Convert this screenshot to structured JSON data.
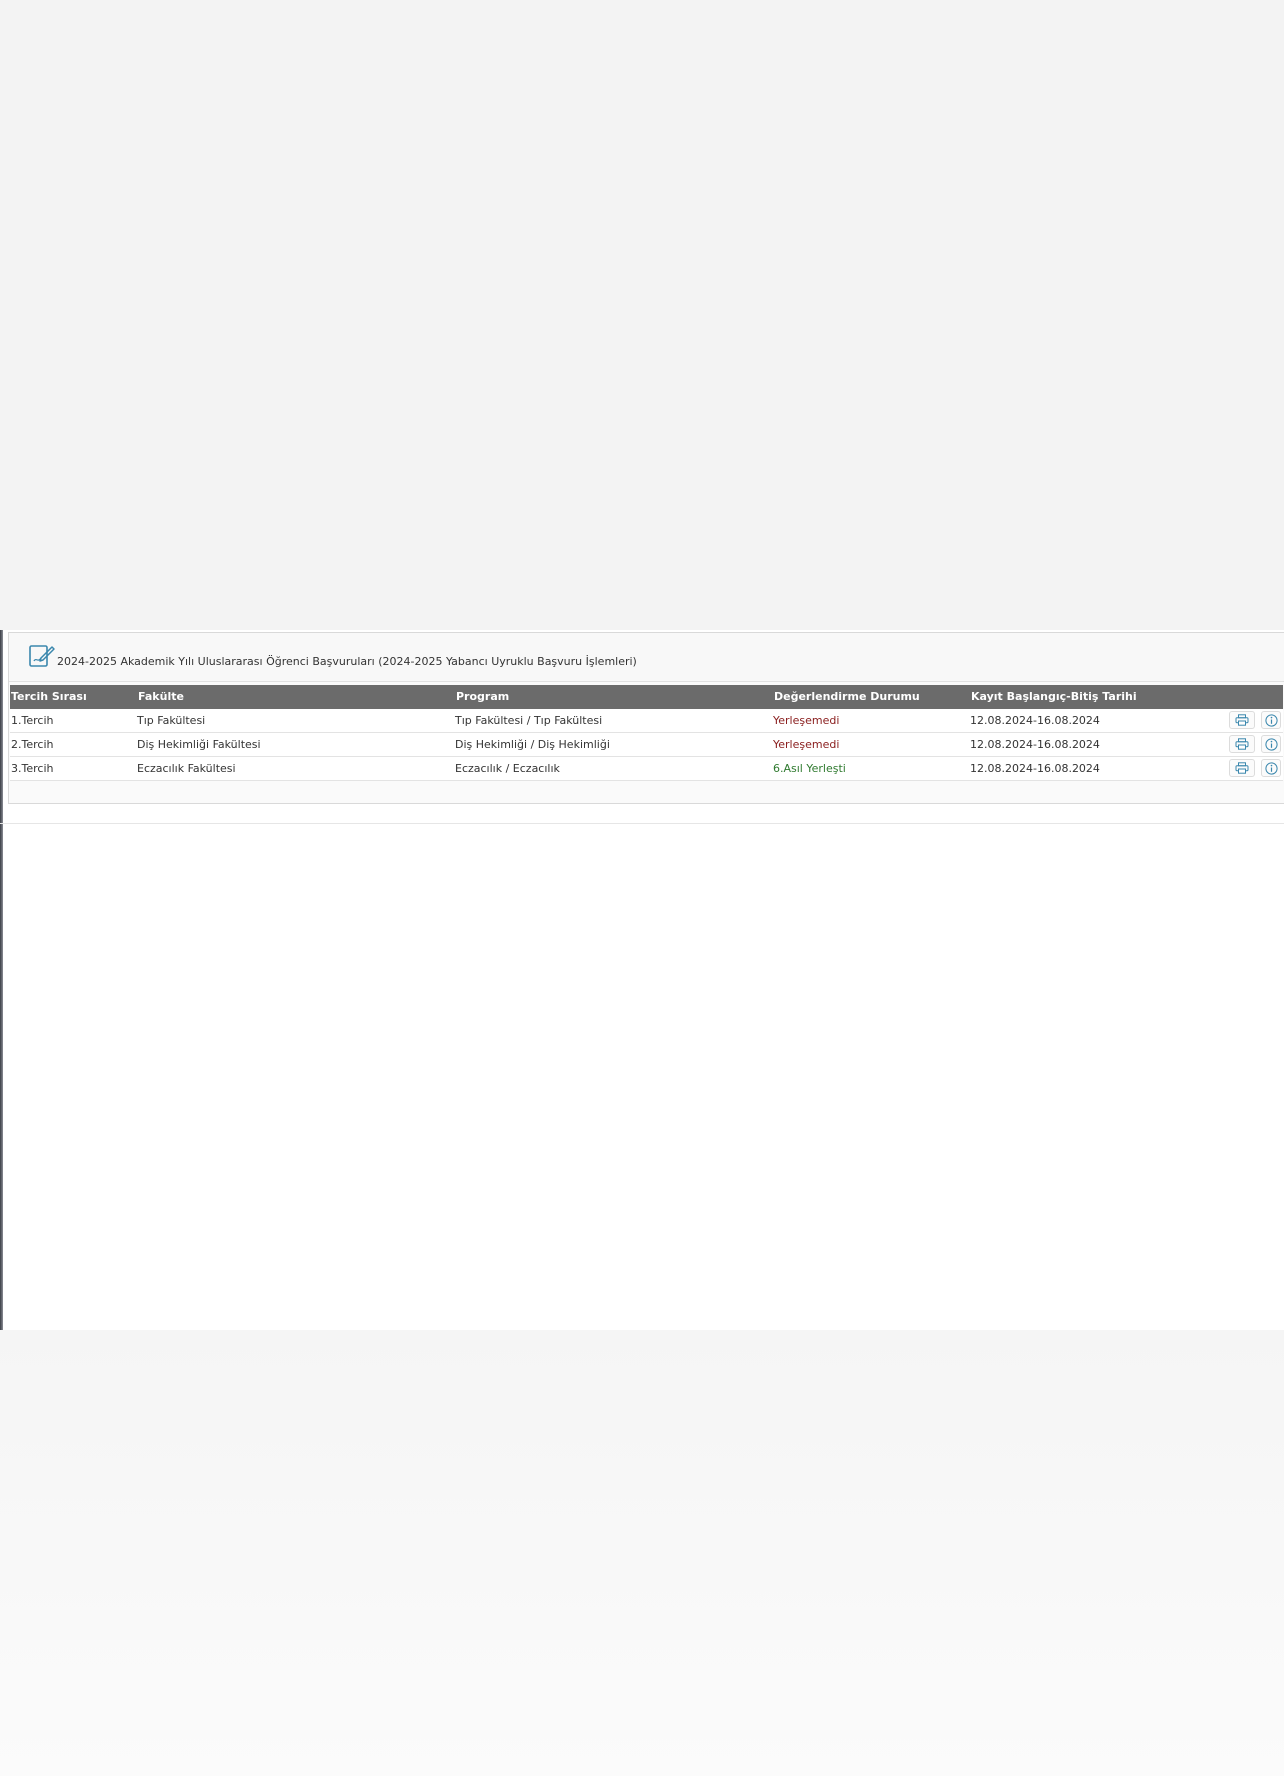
{
  "panel": {
    "title": "2024-2025 Akademik Yılı Uluslararası Öğrenci Başvuruları (2024-2025 Yabancı Uyruklu Başvuru İşlemleri)",
    "icon": "edit-document-icon"
  },
  "table": {
    "headers": {
      "rank": "Tercih Sırası",
      "faculty": "Fakülte",
      "program": "Program",
      "status": "Değerlendirme Durumu",
      "dates": "Kayıt Başlangıç-Bitiş Tarihi"
    },
    "rows": [
      {
        "rank": "1.Tercih",
        "faculty": "Tıp Fakültesi",
        "program": "Tıp Fakültesi / Tıp Fakültesi",
        "status": "Yerleşemedi",
        "dates": "12.08.2024-16.08.2024"
      },
      {
        "rank": "2.Tercih",
        "faculty": "Diş Hekimliği Fakültesi",
        "program": "Diş Hekimliği / Diş Hekimliği",
        "status": "Yerleşemedi",
        "dates": "12.08.2024-16.08.2024"
      },
      {
        "rank": "3.Tercih",
        "faculty": "Eczacılık Fakültesi",
        "program": "Eczacılık / Eczacılık",
        "status": "6.Asıl Yerleşti",
        "dates": "12.08.2024-16.08.2024"
      }
    ]
  },
  "colors": {
    "header_bg": "#6b6b6b",
    "status_fail": "#8b2020",
    "status_ok": "#2f7a2f",
    "icon_accent": "#3a87ad"
  },
  "icons": {
    "print": "printer-icon",
    "info": "info-icon"
  }
}
